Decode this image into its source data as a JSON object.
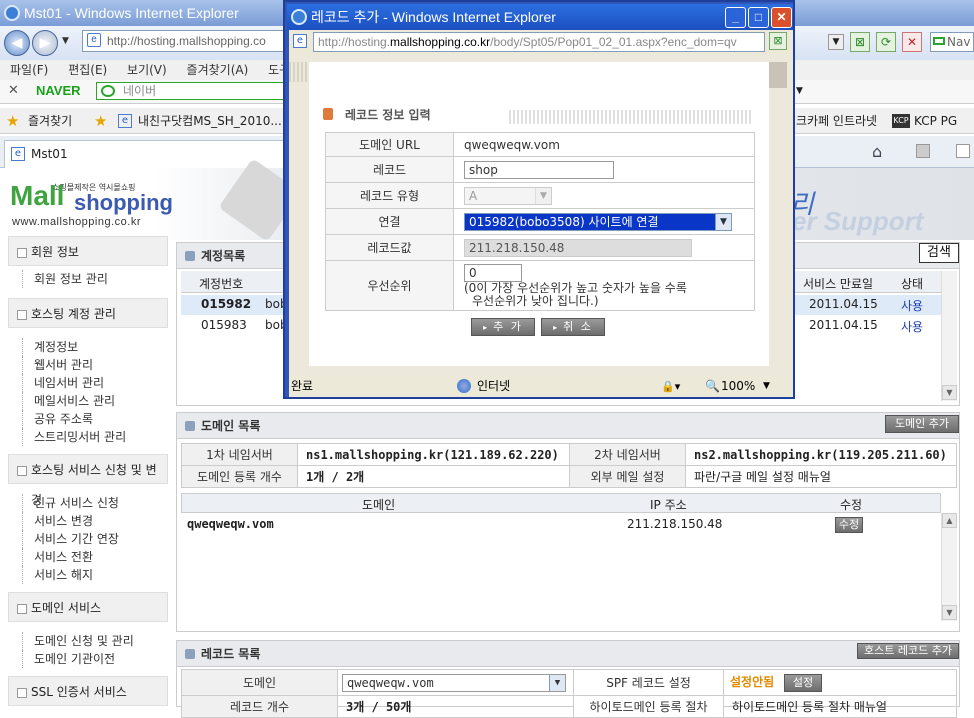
{
  "main_window": {
    "title": "Mst01 - Windows Internet Explorer",
    "address": "http://hosting.mallshopping.co",
    "menu": [
      "파일(F)",
      "편집(E)",
      "보기(V)",
      "즐겨찾기(A)",
      "도구"
    ],
    "naver_label": "NAVER",
    "naver_placeholder": "네이버",
    "favorites_label": "즐겨찾기",
    "fav_link1": "내친구닷컴MS_SH_2010...",
    "fav_link2": "크카페 인트라넷",
    "fav_link3": "KCP PG",
    "tab_title": "Mst01",
    "nav_right": "Nav"
  },
  "logo": {
    "tagline": "쇼핑몰제작은 역시몰쇼핑",
    "mall": "Mall",
    "shopping": "shopping",
    "url": "www.mallshopping.co.kr"
  },
  "banner": {
    "text1": "리",
    "text2": "er Support"
  },
  "leftnav": {
    "sec1": "회원 정보",
    "sec1_items": [
      "회원 정보 관리"
    ],
    "sec2": "호스팅 계정 관리",
    "sec2_items": [
      "계정정보",
      "웹서버 관리",
      "네임서버 관리",
      "메일서비스 관리",
      "공유 주소록",
      "스트리밍서버 관리"
    ],
    "sec3": "호스팅 서비스 신청 및 변경",
    "sec3_items": [
      "신규 서비스 신청",
      "서비스 변경",
      "서비스 기간 연장",
      "서비스 전환",
      "서비스 해지"
    ],
    "sec4": "도메인 서비스",
    "sec4_items": [
      "도메인 신청 및 관리",
      "도메인 기관이전"
    ],
    "sec5": "SSL 인증서 서비스"
  },
  "accounts": {
    "title": "계정목록",
    "search_button": "검색",
    "col_no": "계정번호",
    "col_expire": "서비스 만료일",
    "col_status": "상태",
    "rows": [
      {
        "no": "015982",
        "user": "bob",
        "expire": "2011.04.15",
        "status": "사용"
      },
      {
        "no": "015983",
        "user": "bob",
        "expire": "2011.04.15",
        "status": "사용"
      }
    ]
  },
  "domains": {
    "title": "도메인 목록",
    "add_button": "도메인 추가",
    "ns1_label": "1차 네임서버",
    "ns1_value": "ns1.mallshopping.kr(121.189.62.220)",
    "ns2_label": "2차 네임서버",
    "ns2_value": "ns2.mallshopping.kr(119.205.211.60)",
    "count_label": "도메인 등록 개수",
    "count_value": "1개 / 2개",
    "mail_label": "외부 메일 설정",
    "mail_value": "파란/구글 메일 설정 매뉴얼",
    "col_domain": "도메인",
    "col_ip": "IP 주소",
    "col_edit": "수정",
    "rows": [
      {
        "domain": "qweqweqw.vom",
        "ip": "211.218.150.48",
        "edit": "수정"
      }
    ]
  },
  "records": {
    "title": "레코드 목록",
    "add_button": "호스트 레코드 추가",
    "domain_label": "도메인",
    "domain_value": "qweqweqw.vom",
    "spf_label": "SPF 레코드 설정",
    "spf_status": "설정안됨",
    "spf_button": "설정",
    "count_label": "레코드 개수",
    "count_value": "3개 / 50개",
    "guide_label": "하이토드메인 등록 절차",
    "guide_value": "하이토드메인 등록 절차 매뉴얼"
  },
  "popup": {
    "title": "레코드 추가 - Windows Internet Explorer",
    "address_pre": "http://hosting.",
    "address_host": "mallshopping.co.kr",
    "address_post": "/body/Spt05/Pop01_02_01.aspx?enc_dom=qv",
    "section_title": "레코드 정보 입력",
    "domain_url_label": "도메인 URL",
    "domain_url_value": "qweqweqw.vom",
    "record_label": "레코드",
    "record_value": "shop",
    "type_label": "레코드 유형",
    "type_value": "A",
    "link_label": "연결",
    "link_value": "015982(bobo3508) 사이트에 연결",
    "value_label": "레코드값",
    "value_value": "211.218.150.48",
    "priority_label": "우선순위",
    "priority_value": "0",
    "priority_help1": "(0이 가장 우선순위가 높고 숫자가 높을 수록",
    "priority_help2": "우선순위가 낮아 집니다.)",
    "add_button": "추 가",
    "cancel_button": "취 소",
    "status_left": "완료",
    "status_zone": "인터넷",
    "zoom": "100%"
  }
}
